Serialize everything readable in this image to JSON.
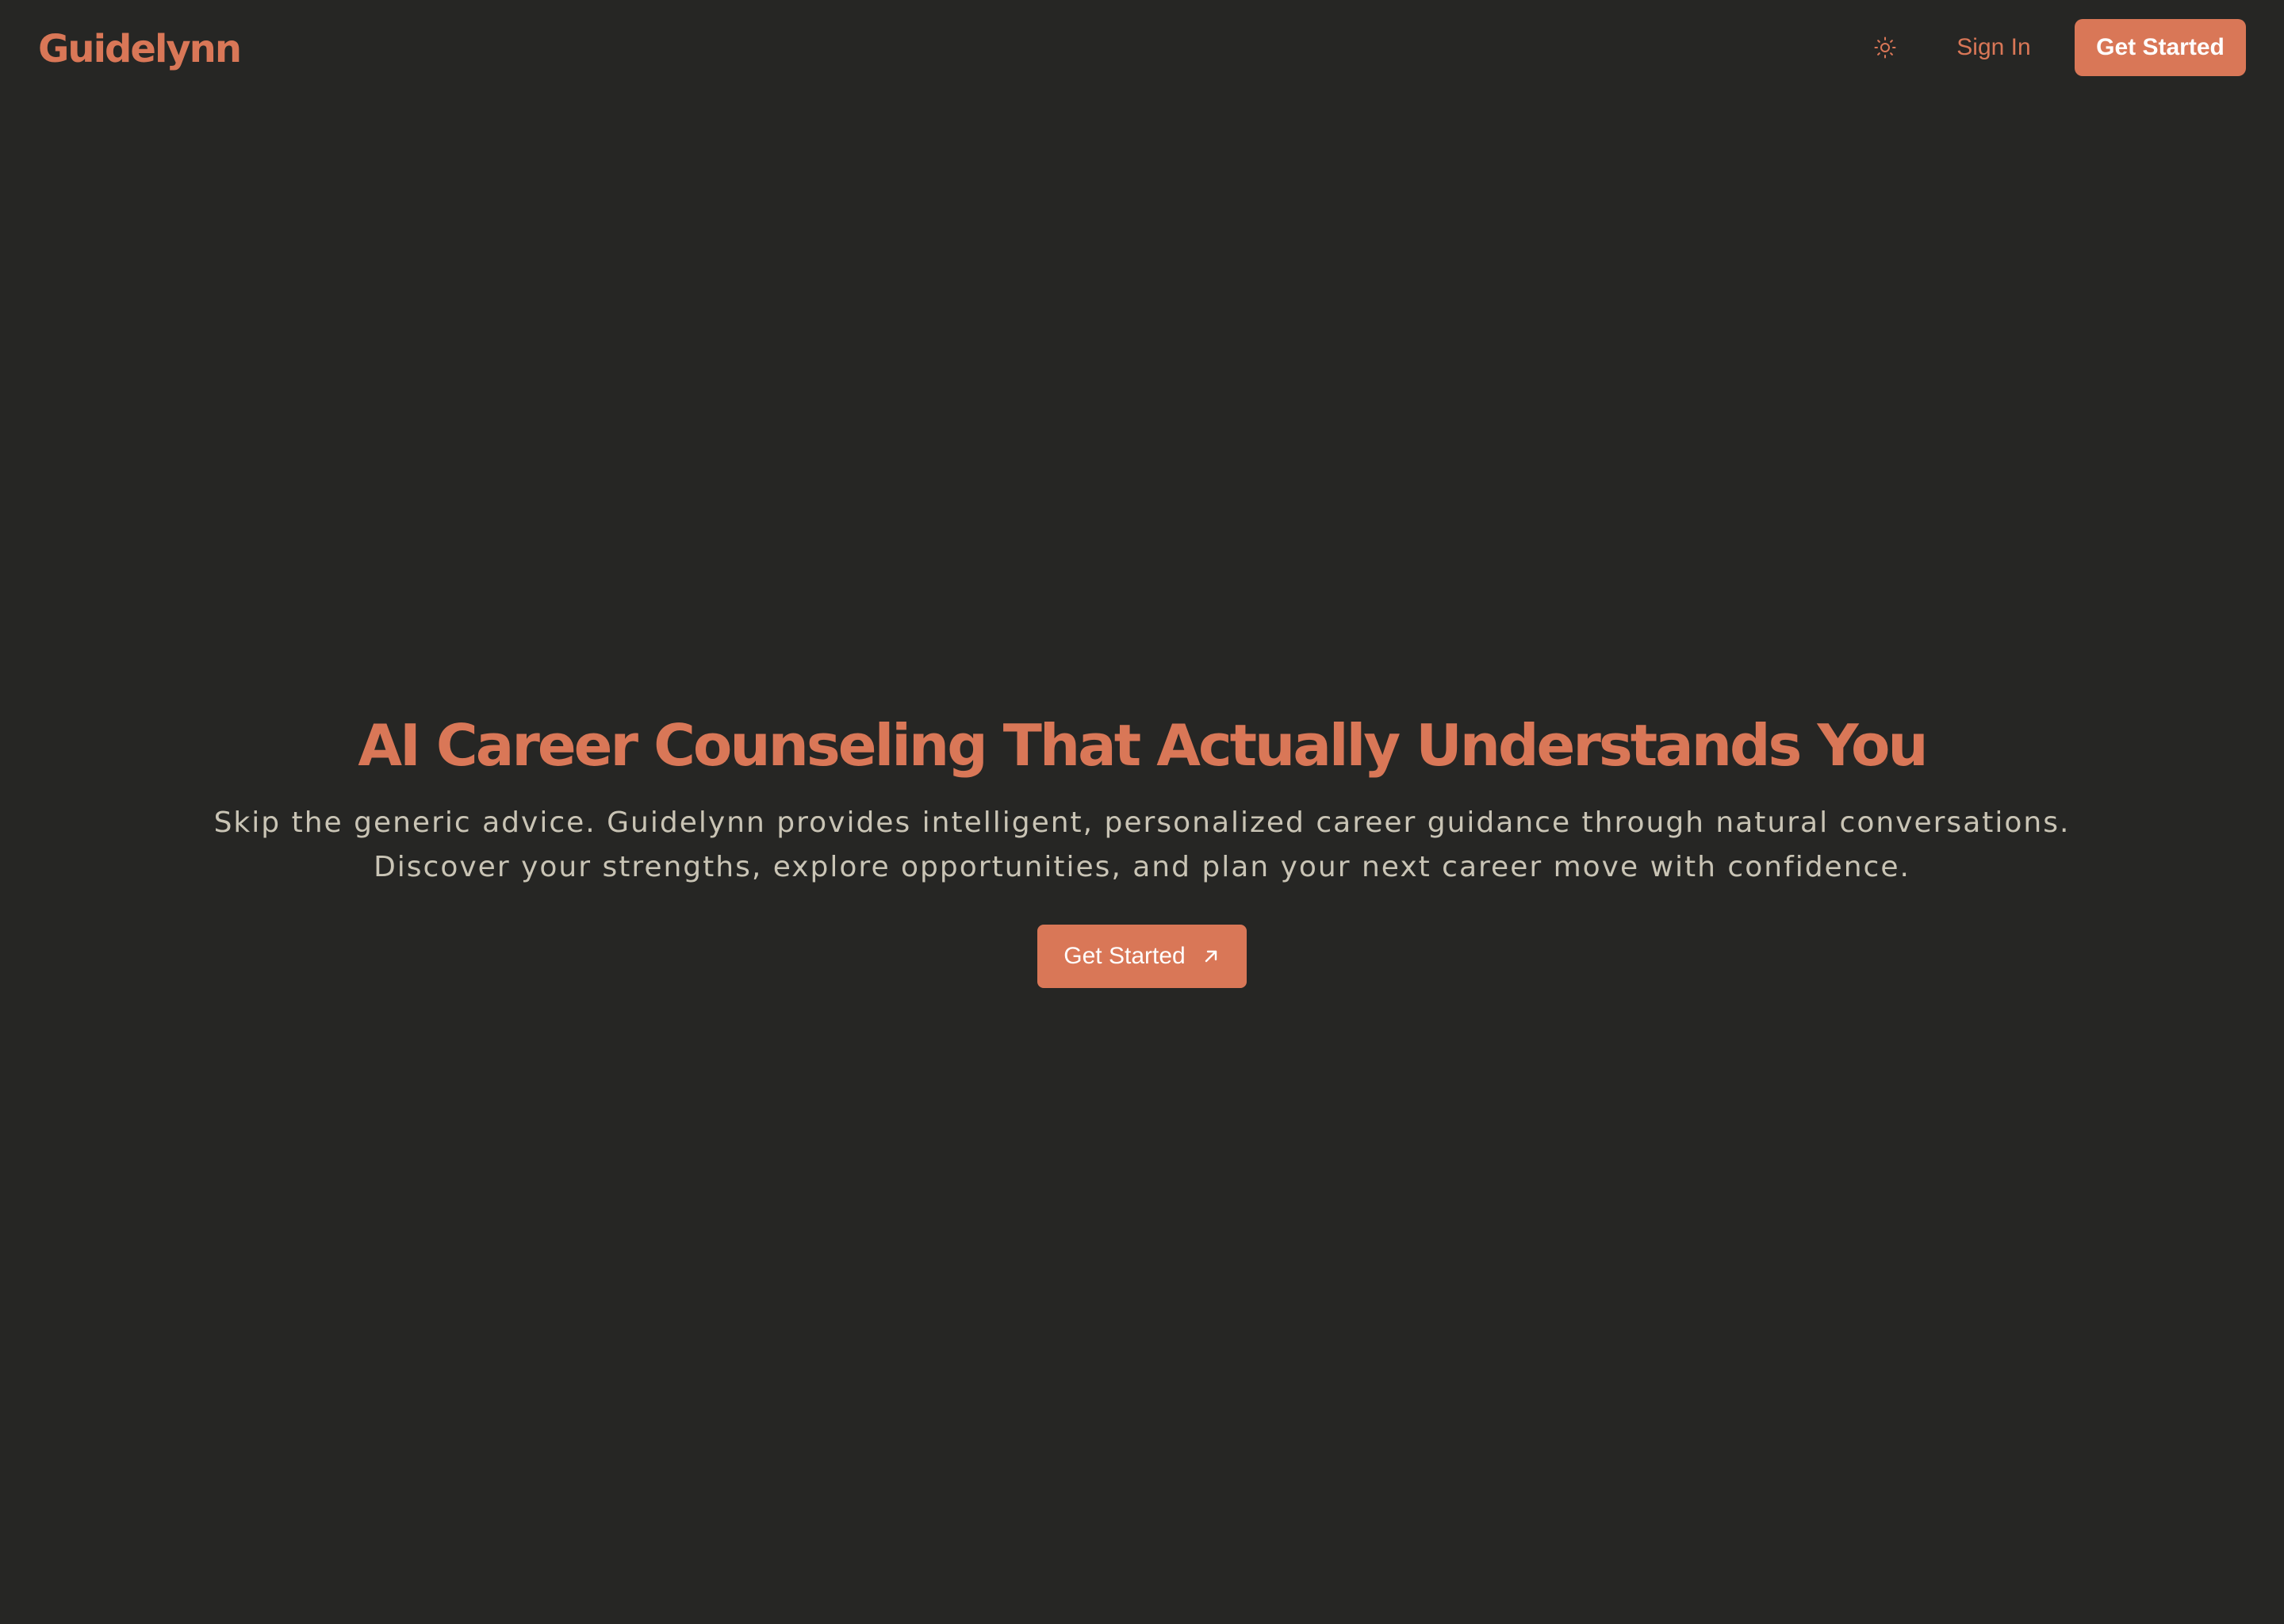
{
  "header": {
    "logo": "Guidelynn",
    "theme_toggle_icon": "sun-icon",
    "sign_in_label": "Sign In",
    "get_started_label": "Get Started"
  },
  "hero": {
    "title": "AI Career Counseling That Actually Understands You",
    "subtitle_line1": "Skip the generic advice. Guidelynn provides intelligent, personalized career guidance through natural conversations.",
    "subtitle_line2": "Discover your strengths, explore opportunities, and plan your next career move with confidence.",
    "cta_label": "Get Started",
    "cta_icon": "arrow-up-right-icon"
  },
  "colors": {
    "background": "#262624",
    "accent": "#d97757",
    "body_text": "#c9c4b5",
    "button_text": "#ffffff"
  }
}
